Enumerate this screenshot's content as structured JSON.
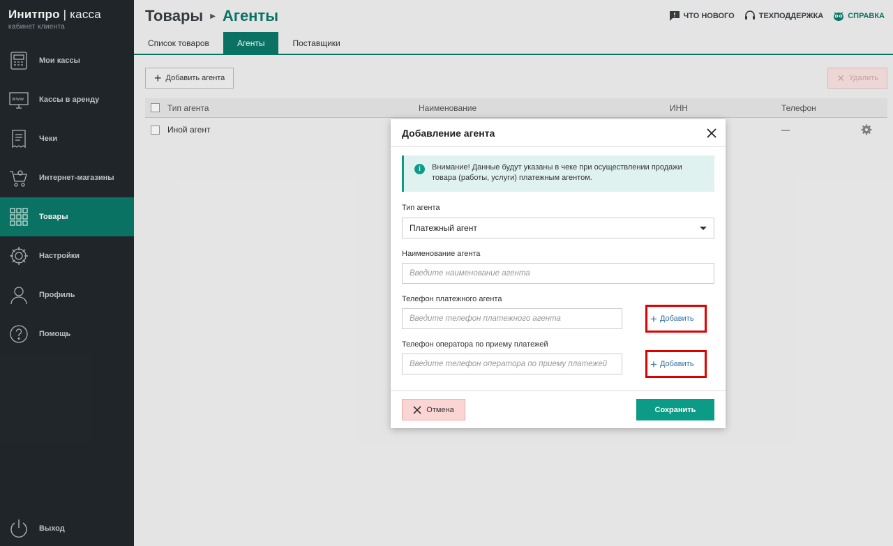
{
  "brand": {
    "name": "Инитпро",
    "product": "касса",
    "subtitle": "кабинет клиента"
  },
  "sidebar": {
    "items": [
      {
        "label": "Мои кассы",
        "icon": "cash-register-icon"
      },
      {
        "label": "Кассы в аренду",
        "icon": "www-monitor-icon"
      },
      {
        "label": "Чеки",
        "icon": "receipt-icon"
      },
      {
        "label": "Интернет-магазины",
        "icon": "cart-icon"
      },
      {
        "label": "Товары",
        "icon": "grid-icon",
        "active": true
      },
      {
        "label": "Настройки",
        "icon": "gear-icon"
      },
      {
        "label": "Профиль",
        "icon": "user-icon"
      },
      {
        "label": "Помощь",
        "icon": "question-icon"
      }
    ],
    "logout": "Выход"
  },
  "header": {
    "title": "Товары",
    "current": "Агенты",
    "links": {
      "whats_new": "ЧТО НОВОГО",
      "support": "ТЕХПОДДЕРЖКА",
      "help": "СПРАВКА"
    }
  },
  "tabs": [
    {
      "label": "Список товаров"
    },
    {
      "label": "Агенты",
      "active": true
    },
    {
      "label": "Поставщики"
    }
  ],
  "toolbar": {
    "add_agent": "Добавить агента",
    "delete": "Удалить"
  },
  "table": {
    "columns": [
      "Тип агента",
      "Наименование",
      "ИНН",
      "Телефон"
    ],
    "rows": [
      {
        "type": "Иной агент",
        "phone": "—"
      }
    ]
  },
  "modal": {
    "title": "Добавление агента",
    "notice": "Внимание! Данные будут указаны в чеке при осуществлении продажи товара (работы, услуги) платежным агентом.",
    "agent_type_label": "Тип агента",
    "agent_type_value": "Платежный агент",
    "name_label": "Наименование агента",
    "name_placeholder": "Введите наименование агента",
    "phone_agent_label": "Телефон платежного агента",
    "phone_agent_placeholder": "Введите телефон платежного агента",
    "phone_operator_label": "Телефон оператора по приему платежей",
    "phone_operator_placeholder": "Введите телефон оператора по приему платежей",
    "add_label": "Добавить",
    "cancel_label": "Отмена",
    "save_label": "Сохранить"
  },
  "colors": {
    "accent": "#0b7a6a",
    "sidebar_bg": "#23282d",
    "highlight": "#e00000"
  }
}
